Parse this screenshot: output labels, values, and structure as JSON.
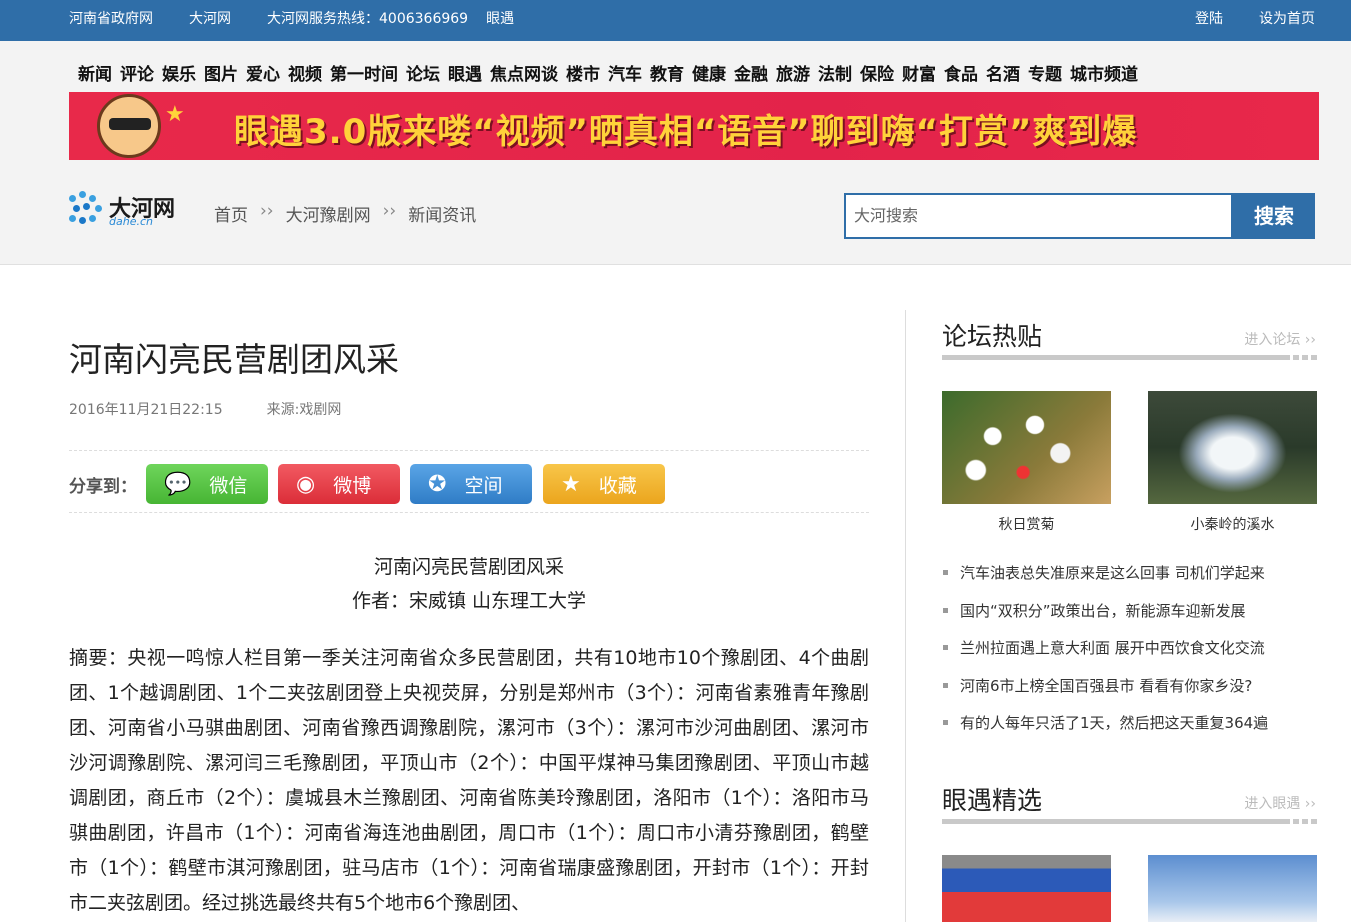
{
  "topbar": {
    "links": [
      "河南省政府网",
      "大河网"
    ],
    "hotline": "大河网服务热线：4006366969",
    "yanyu": "眼遇",
    "login": "登陆",
    "set_home": "设为首页"
  },
  "nav": [
    "新闻",
    "评论",
    "娱乐",
    "图片",
    "爱心",
    "视频",
    "第一时间",
    "论坛",
    "眼遇",
    "焦点网谈",
    "楼市",
    "汽车",
    "教育",
    "健康",
    "金融",
    "旅游",
    "法制",
    "保险",
    "财富",
    "食品",
    "名酒",
    "专题",
    "城市频道"
  ],
  "banner": {
    "text": "眼遇3.0版来喽“视频”晒真相“语音”聊到嗨“打赏”爽到爆"
  },
  "logo": {
    "name": "大河网",
    "sub": "dahe.cn"
  },
  "breadcrumb": [
    "首页",
    "大河豫剧网",
    "新闻资讯"
  ],
  "breadcrumb_sep": "››",
  "search": {
    "placeholder": "大河搜索",
    "button": "搜索"
  },
  "article": {
    "title": "河南闪亮民营剧团风采",
    "date": "2016年11月21日22:15",
    "source": "来源:戏剧网",
    "share_label": "分享到：",
    "share": [
      {
        "label": "微信",
        "icon": "wechat-icon",
        "color": "#5cc64a"
      },
      {
        "label": "微博",
        "icon": "weibo-icon",
        "color": "#e8414a"
      },
      {
        "label": "空间",
        "icon": "qzone-icon",
        "color": "#3d8fd6"
      },
      {
        "label": "收藏",
        "icon": "star-icon",
        "color": "#f1b42e"
      }
    ],
    "subtitle": "河南闪亮民营剧团风采",
    "author": "作者：宋威镇 山东理工大学",
    "abstract": "摘要：央视一鸣惊人栏目第一季关注河南省众多民营剧团，共有10地市10个豫剧团、4个曲剧团、1个越调剧团、1个二夹弦剧团登上央视荧屏，分别是郑州市（3个）：河南省素雅青年豫剧团、河南省小马骐曲剧团、河南省豫西调豫剧院，漯河市（3个）：漯河市沙河曲剧团、漯河市沙河调豫剧院、漯河闫三毛豫剧团，平顶山市（2个）：中国平煤神马集团豫剧团、平顶山市越调剧团，商丘市（2个）：虞城县木兰豫剧团、河南省陈美玲豫剧团，洛阳市（1个）：洛阳市马骐曲剧团，许昌市（1个）：河南省海连池曲剧团，周口市（1个）：周口市小清芬豫剧团，鹤壁市（1个）：鹤壁市淇河豫剧团，驻马店市（1个）：河南省瑞康盛豫剧团，开封市（1个）：开封市二夹弦剧团。经过挑选最终共有5个地市6个豫剧团、"
  },
  "sidebar": {
    "forum": {
      "title": "论坛热贴",
      "more": "进入论坛",
      "thumbs": [
        {
          "caption": "秋日赏菊"
        },
        {
          "caption": "小秦岭的溪水"
        }
      ],
      "items": [
        "汽车油表总失准原来是这么回事 司机们学起来",
        "国内“双积分”政策出台，新能源车迎新发展",
        "兰州拉面遇上意大利面 展开中西饮食文化交流",
        "河南6市上榜全国百强县市 看看有你家乡没?",
        "有的人每年只活了1天，然后把这天重复364遍"
      ]
    },
    "yanyu": {
      "title": "眼遇精选",
      "more": "进入眼遇"
    }
  }
}
